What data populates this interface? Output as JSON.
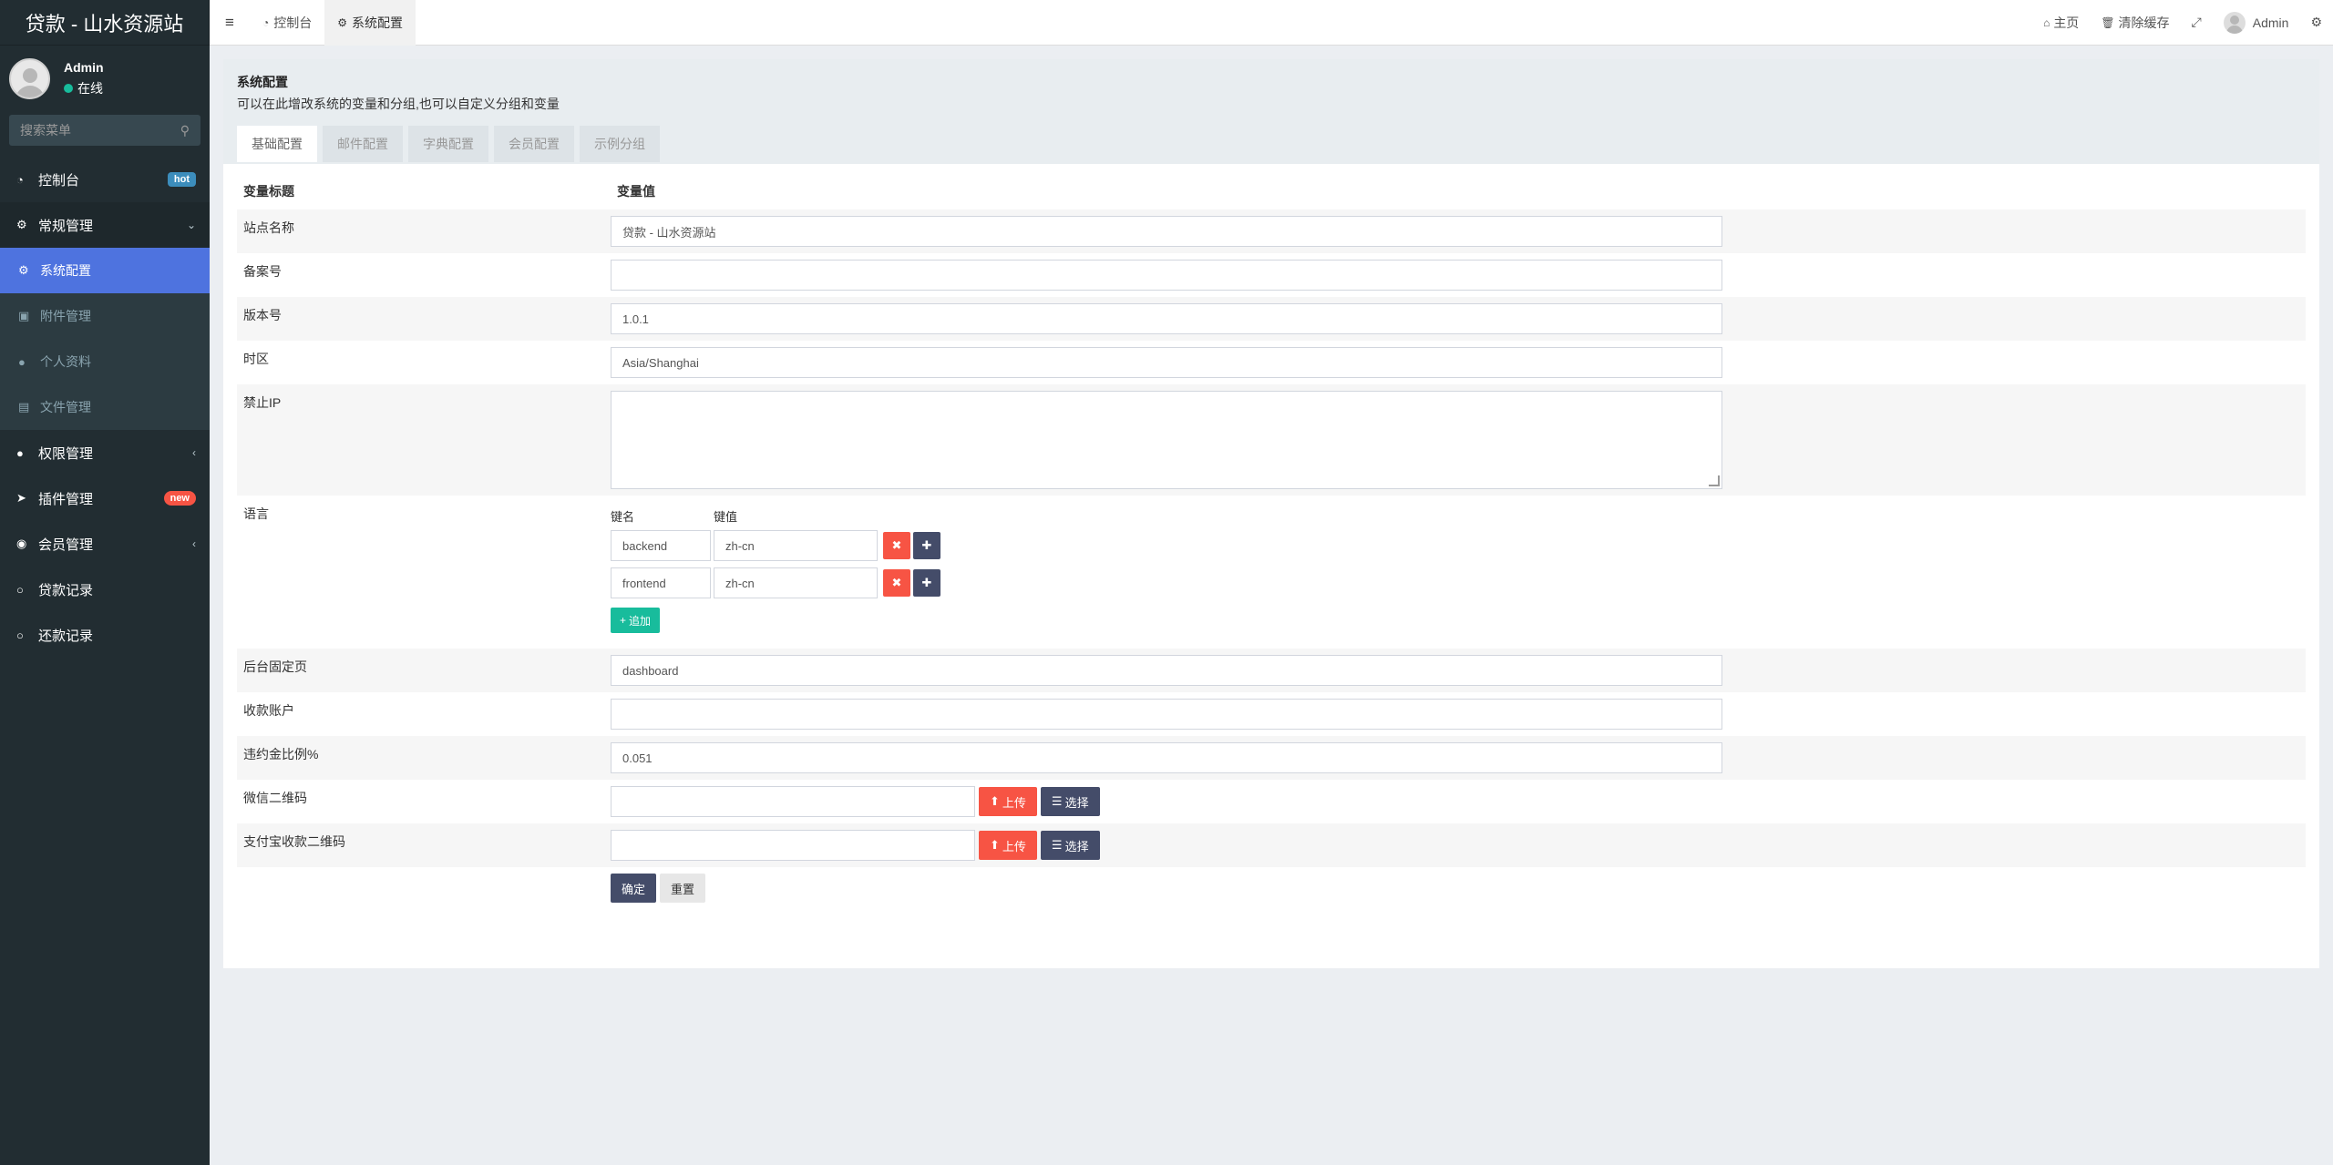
{
  "brand": "贷款 - 山水资源站",
  "user": {
    "name": "Admin",
    "status": "在线"
  },
  "sidebar": {
    "search_placeholder": "搜索菜单",
    "items": [
      {
        "label": "控制台",
        "badge": "hot"
      },
      {
        "label": "常规管理"
      },
      {
        "label": "系统配置"
      },
      {
        "label": "附件管理"
      },
      {
        "label": "个人资料"
      },
      {
        "label": "文件管理"
      },
      {
        "label": "权限管理"
      },
      {
        "label": "插件管理",
        "badge": "new"
      },
      {
        "label": "会员管理"
      },
      {
        "label": "贷款记录"
      },
      {
        "label": "还款记录"
      }
    ]
  },
  "header": {
    "tabs": [
      "控制台",
      "系统配置"
    ],
    "home": "主页",
    "clear_cache": "清除缓存",
    "admin": "Admin"
  },
  "panel": {
    "title": "系统配置",
    "desc": "可以在此增改系统的变量和分组,也可以自定义分组和变量",
    "tabs": [
      "基础配置",
      "邮件配置",
      "字典配置",
      "会员配置",
      "示例分组"
    ]
  },
  "form": {
    "col_title": "变量标题",
    "col_value": "变量值",
    "site_name_label": "站点名称",
    "site_name": "贷款 - 山水资源站",
    "beian_label": "备案号",
    "beian": "",
    "version_label": "版本号",
    "version": "1.0.1",
    "timezone_label": "时区",
    "timezone": "Asia/Shanghai",
    "forbid_ip_label": "禁止IP",
    "language_label": "语言",
    "key_name": "键名",
    "key_value": "键值",
    "lang_rows": [
      {
        "key": "backend",
        "value": "zh-cn"
      },
      {
        "key": "frontend",
        "value": "zh-cn"
      }
    ],
    "append": "追加",
    "fixed_page_label": "后台固定页",
    "fixed_page": "dashboard",
    "account_label": "收款账户",
    "account": "",
    "penalty_label": "违约金比例%",
    "penalty": "0.051",
    "wechat_qr_label": "微信二维码",
    "alipay_qr_label": "支付宝收款二维码",
    "upload": "上传",
    "select": "选择",
    "submit": "确定",
    "reset": "重置"
  }
}
